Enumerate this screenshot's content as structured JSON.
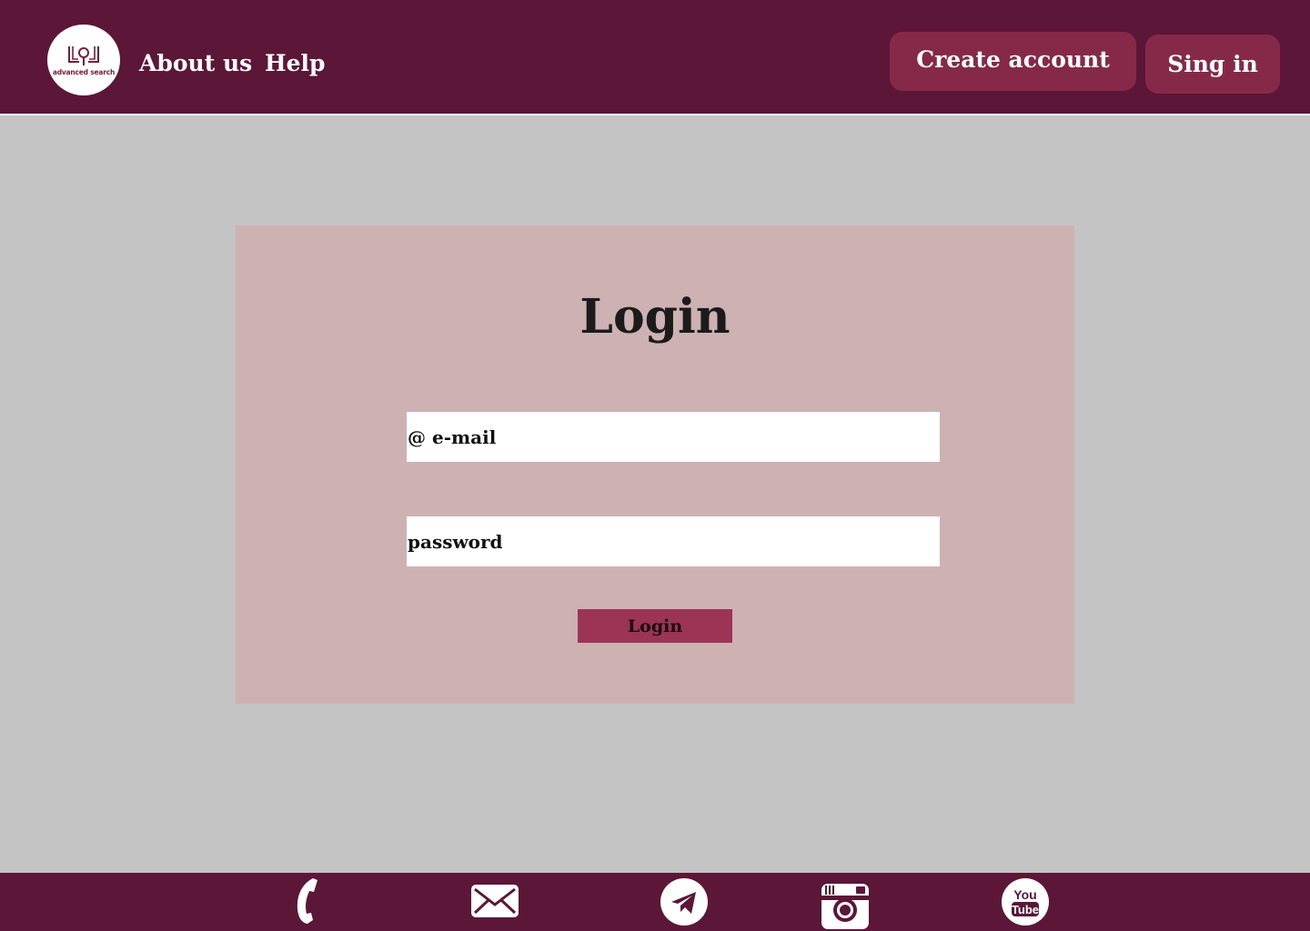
{
  "header": {
    "logo_text": "advanced search",
    "nav": {
      "about": "About us",
      "help": "Help"
    },
    "create_account": "Create account",
    "sign_in": "Sing in"
  },
  "login": {
    "title": "Login",
    "email_placeholder": "@ e-mail",
    "password_placeholder": "password",
    "submit": "Login"
  },
  "footer": {
    "icons": [
      "phone-icon",
      "mail-icon",
      "telegram-icon",
      "instagram-icon",
      "youtube-icon"
    ],
    "youtube_top": "You",
    "youtube_bottom": "Tube"
  },
  "colors": {
    "header_bg": "#5c1637",
    "button_bg": "#862848",
    "page_bg": "#c4c4c4",
    "card_bg": "#ceb1b3",
    "login_button": "#9c3455"
  }
}
